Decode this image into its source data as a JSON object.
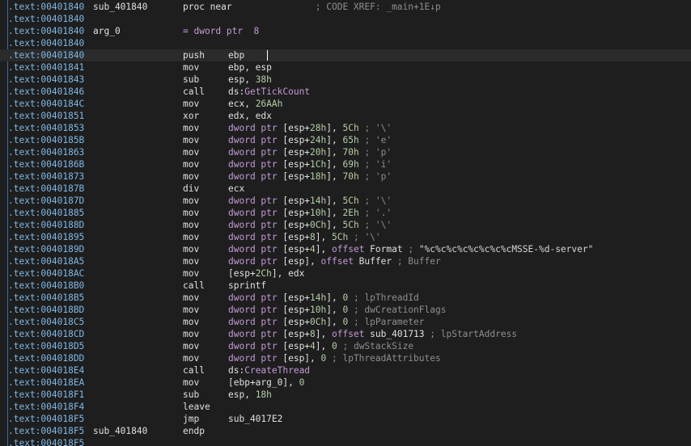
{
  "lines": [
    {
      "addr": ".text:00401840",
      "label": "sub_401840",
      "mnem": "proc near",
      "ops": [
        {
          "t": "                ; CODE XREF: _main+1E↓p",
          "c": "c"
        }
      ]
    },
    {
      "addr": ".text:00401840",
      "label": "",
      "mnem": "",
      "ops": []
    },
    {
      "addr": ".text:00401840",
      "label": "arg_0",
      "mnem": "= dword ptr  8",
      "ops": []
    },
    {
      "addr": ".text:00401840",
      "label": "",
      "mnem": "",
      "ops": []
    },
    {
      "addr": ".text:00401840",
      "label": "",
      "mnem": "push",
      "ops": [
        {
          "t": "ebp",
          "c": "w"
        }
      ],
      "current": true
    },
    {
      "addr": ".text:00401841",
      "label": "",
      "mnem": "mov",
      "ops": [
        {
          "t": "ebp, esp",
          "c": "w"
        }
      ]
    },
    {
      "addr": ".text:00401843",
      "label": "",
      "mnem": "sub",
      "ops": [
        {
          "t": "esp, ",
          "c": "w"
        },
        {
          "t": "38h",
          "c": "n"
        }
      ]
    },
    {
      "addr": ".text:00401846",
      "label": "",
      "mnem": "call",
      "ops": [
        {
          "t": "ds:",
          "c": "w"
        },
        {
          "t": "GetTickCount",
          "c": "k"
        }
      ]
    },
    {
      "addr": ".text:0040184C",
      "label": "",
      "mnem": "mov",
      "ops": [
        {
          "t": "ecx, ",
          "c": "w"
        },
        {
          "t": "26AAh",
          "c": "n"
        }
      ]
    },
    {
      "addr": ".text:00401851",
      "label": "",
      "mnem": "xor",
      "ops": [
        {
          "t": "edx, edx",
          "c": "w"
        }
      ]
    },
    {
      "addr": ".text:00401853",
      "label": "",
      "mnem": "mov",
      "ops": [
        {
          "t": "dword ptr ",
          "c": "k"
        },
        {
          "t": "[esp+",
          "c": "w"
        },
        {
          "t": "28h",
          "c": "n"
        },
        {
          "t": "], ",
          "c": "w"
        },
        {
          "t": "5Ch",
          "c": "n"
        },
        {
          "t": " ; '\\'",
          "c": "c"
        }
      ]
    },
    {
      "addr": ".text:0040185B",
      "label": "",
      "mnem": "mov",
      "ops": [
        {
          "t": "dword ptr ",
          "c": "k"
        },
        {
          "t": "[esp+",
          "c": "w"
        },
        {
          "t": "24h",
          "c": "n"
        },
        {
          "t": "], ",
          "c": "w"
        },
        {
          "t": "65h",
          "c": "n"
        },
        {
          "t": " ; 'e'",
          "c": "c"
        }
      ]
    },
    {
      "addr": ".text:00401863",
      "label": "",
      "mnem": "mov",
      "ops": [
        {
          "t": "dword ptr ",
          "c": "k"
        },
        {
          "t": "[esp+",
          "c": "w"
        },
        {
          "t": "20h",
          "c": "n"
        },
        {
          "t": "], ",
          "c": "w"
        },
        {
          "t": "70h",
          "c": "n"
        },
        {
          "t": " ; 'p'",
          "c": "c"
        }
      ]
    },
    {
      "addr": ".text:0040186B",
      "label": "",
      "mnem": "mov",
      "ops": [
        {
          "t": "dword ptr ",
          "c": "k"
        },
        {
          "t": "[esp+",
          "c": "w"
        },
        {
          "t": "1Ch",
          "c": "n"
        },
        {
          "t": "], ",
          "c": "w"
        },
        {
          "t": "69h",
          "c": "n"
        },
        {
          "t": " ; 'i'",
          "c": "c"
        }
      ]
    },
    {
      "addr": ".text:00401873",
      "label": "",
      "mnem": "mov",
      "ops": [
        {
          "t": "dword ptr ",
          "c": "k"
        },
        {
          "t": "[esp+",
          "c": "w"
        },
        {
          "t": "18h",
          "c": "n"
        },
        {
          "t": "], ",
          "c": "w"
        },
        {
          "t": "70h",
          "c": "n"
        },
        {
          "t": " ; 'p'",
          "c": "c"
        }
      ]
    },
    {
      "addr": ".text:0040187B",
      "label": "",
      "mnem": "div",
      "ops": [
        {
          "t": "ecx",
          "c": "w"
        }
      ]
    },
    {
      "addr": ".text:0040187D",
      "label": "",
      "mnem": "mov",
      "ops": [
        {
          "t": "dword ptr ",
          "c": "k"
        },
        {
          "t": "[esp+",
          "c": "w"
        },
        {
          "t": "14h",
          "c": "n"
        },
        {
          "t": "], ",
          "c": "w"
        },
        {
          "t": "5Ch",
          "c": "n"
        },
        {
          "t": " ; '\\'",
          "c": "c"
        }
      ]
    },
    {
      "addr": ".text:00401885",
      "label": "",
      "mnem": "mov",
      "ops": [
        {
          "t": "dword ptr ",
          "c": "k"
        },
        {
          "t": "[esp+",
          "c": "w"
        },
        {
          "t": "10h",
          "c": "n"
        },
        {
          "t": "], ",
          "c": "w"
        },
        {
          "t": "2Eh",
          "c": "n"
        },
        {
          "t": " ; '.'",
          "c": "c"
        }
      ]
    },
    {
      "addr": ".text:0040188D",
      "label": "",
      "mnem": "mov",
      "ops": [
        {
          "t": "dword ptr ",
          "c": "k"
        },
        {
          "t": "[esp+",
          "c": "w"
        },
        {
          "t": "0Ch",
          "c": "n"
        },
        {
          "t": "], ",
          "c": "w"
        },
        {
          "t": "5Ch",
          "c": "n"
        },
        {
          "t": " ; '\\'",
          "c": "c"
        }
      ]
    },
    {
      "addr": ".text:00401895",
      "label": "",
      "mnem": "mov",
      "ops": [
        {
          "t": "dword ptr ",
          "c": "k"
        },
        {
          "t": "[esp+",
          "c": "w"
        },
        {
          "t": "8",
          "c": "n"
        },
        {
          "t": "], ",
          "c": "w"
        },
        {
          "t": "5Ch",
          "c": "n"
        },
        {
          "t": " ; '\\'",
          "c": "c"
        }
      ]
    },
    {
      "addr": ".text:0040189D",
      "label": "",
      "mnem": "mov",
      "ops": [
        {
          "t": "dword ptr ",
          "c": "k"
        },
        {
          "t": "[esp+",
          "c": "w"
        },
        {
          "t": "4",
          "c": "n"
        },
        {
          "t": "], ",
          "c": "w"
        },
        {
          "t": "offset ",
          "c": "k"
        },
        {
          "t": "Format",
          "c": "w"
        },
        {
          "t": " ; ",
          "c": "c"
        },
        {
          "t": "\"%c%c%c%c%c%c%c%cMSSE-%d-server\"",
          "c": "s"
        }
      ]
    },
    {
      "addr": ".text:004018A5",
      "label": "",
      "mnem": "mov",
      "ops": [
        {
          "t": "dword ptr ",
          "c": "k"
        },
        {
          "t": "[esp], ",
          "c": "w"
        },
        {
          "t": "offset ",
          "c": "k"
        },
        {
          "t": "Buffer",
          "c": "w"
        },
        {
          "t": " ; Buffer",
          "c": "c"
        }
      ]
    },
    {
      "addr": ".text:004018AC",
      "label": "",
      "mnem": "mov",
      "ops": [
        {
          "t": "[esp+",
          "c": "w"
        },
        {
          "t": "2Ch",
          "c": "n"
        },
        {
          "t": "], edx",
          "c": "w"
        }
      ]
    },
    {
      "addr": ".text:004018B0",
      "label": "",
      "mnem": "call",
      "ops": [
        {
          "t": "sprintf",
          "c": "w"
        }
      ]
    },
    {
      "addr": ".text:004018B5",
      "label": "",
      "mnem": "mov",
      "ops": [
        {
          "t": "dword ptr ",
          "c": "k"
        },
        {
          "t": "[esp+",
          "c": "w"
        },
        {
          "t": "14h",
          "c": "n"
        },
        {
          "t": "], ",
          "c": "w"
        },
        {
          "t": "0",
          "c": "n"
        },
        {
          "t": " ; lpThreadId",
          "c": "c"
        }
      ]
    },
    {
      "addr": ".text:004018BD",
      "label": "",
      "mnem": "mov",
      "ops": [
        {
          "t": "dword ptr ",
          "c": "k"
        },
        {
          "t": "[esp+",
          "c": "w"
        },
        {
          "t": "10h",
          "c": "n"
        },
        {
          "t": "], ",
          "c": "w"
        },
        {
          "t": "0",
          "c": "n"
        },
        {
          "t": " ; dwCreationFlags",
          "c": "c"
        }
      ]
    },
    {
      "addr": ".text:004018C5",
      "label": "",
      "mnem": "mov",
      "ops": [
        {
          "t": "dword ptr ",
          "c": "k"
        },
        {
          "t": "[esp+",
          "c": "w"
        },
        {
          "t": "0Ch",
          "c": "n"
        },
        {
          "t": "], ",
          "c": "w"
        },
        {
          "t": "0",
          "c": "n"
        },
        {
          "t": " ; lpParameter",
          "c": "c"
        }
      ]
    },
    {
      "addr": ".text:004018CD",
      "label": "",
      "mnem": "mov",
      "ops": [
        {
          "t": "dword ptr ",
          "c": "k"
        },
        {
          "t": "[esp+",
          "c": "w"
        },
        {
          "t": "8",
          "c": "n"
        },
        {
          "t": "], ",
          "c": "w"
        },
        {
          "t": "offset ",
          "c": "k"
        },
        {
          "t": "sub_401713",
          "c": "w"
        },
        {
          "t": " ; lpStartAddress",
          "c": "c"
        }
      ]
    },
    {
      "addr": ".text:004018D5",
      "label": "",
      "mnem": "mov",
      "ops": [
        {
          "t": "dword ptr ",
          "c": "k"
        },
        {
          "t": "[esp+",
          "c": "w"
        },
        {
          "t": "4",
          "c": "n"
        },
        {
          "t": "], ",
          "c": "w"
        },
        {
          "t": "0",
          "c": "n"
        },
        {
          "t": " ; dwStackSize",
          "c": "c"
        }
      ]
    },
    {
      "addr": ".text:004018DD",
      "label": "",
      "mnem": "mov",
      "ops": [
        {
          "t": "dword ptr ",
          "c": "k"
        },
        {
          "t": "[esp], ",
          "c": "w"
        },
        {
          "t": "0",
          "c": "n"
        },
        {
          "t": " ; lpThreadAttributes",
          "c": "c"
        }
      ]
    },
    {
      "addr": ".text:004018E4",
      "label": "",
      "mnem": "call",
      "ops": [
        {
          "t": "ds:",
          "c": "w"
        },
        {
          "t": "CreateThread",
          "c": "k"
        }
      ]
    },
    {
      "addr": ".text:004018EA",
      "label": "",
      "mnem": "mov",
      "ops": [
        {
          "t": "[ebp+arg_0], ",
          "c": "w"
        },
        {
          "t": "0",
          "c": "n"
        }
      ]
    },
    {
      "addr": ".text:004018F1",
      "label": "",
      "mnem": "sub",
      "ops": [
        {
          "t": "esp, ",
          "c": "w"
        },
        {
          "t": "18h",
          "c": "n"
        }
      ]
    },
    {
      "addr": ".text:004018F4",
      "label": "",
      "mnem": "leave",
      "ops": []
    },
    {
      "addr": ".text:004018F5",
      "label": "",
      "mnem": "jmp",
      "ops": [
        {
          "t": "sub_4017E2",
          "c": "w"
        }
      ]
    },
    {
      "addr": ".text:004018F5",
      "label": "sub_401840",
      "mnem": "endp",
      "ops": []
    },
    {
      "addr": ".text:004018F5",
      "label": "",
      "mnem": "",
      "ops": []
    }
  ],
  "colors": {
    "background": "#1e1e1e",
    "address": "#7fb8e6",
    "keyword": "#c49ad6",
    "number": "#b5cea8",
    "comment": "#8e8e8e",
    "current_line": "#2b2b2b"
  }
}
